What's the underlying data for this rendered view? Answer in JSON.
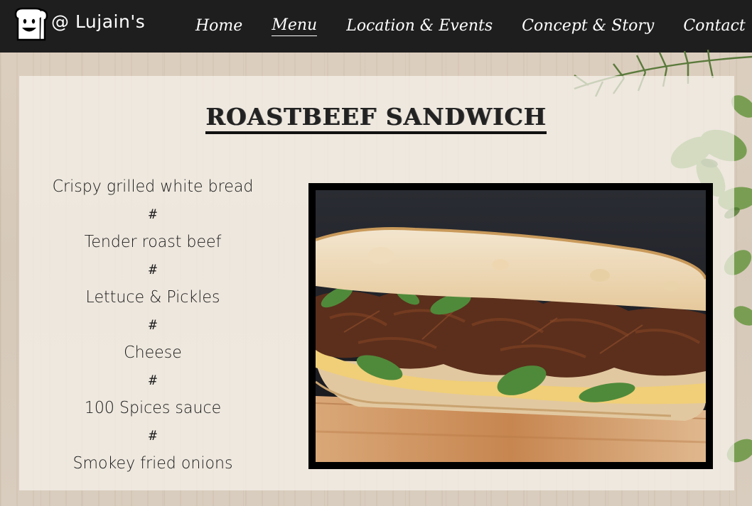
{
  "brand": {
    "name": "@ Lujain's",
    "logo_icon": "smiling-bread-logo"
  },
  "nav": {
    "items": [
      {
        "label": "Home",
        "active": false
      },
      {
        "label": "Menu",
        "active": true
      },
      {
        "label": "Location & Events",
        "active": false
      },
      {
        "label": "Concept & Story",
        "active": false
      },
      {
        "label": "Contact",
        "active": false
      }
    ]
  },
  "item": {
    "title": "ROASTBEEF SANDWICH",
    "ingredients": [
      "Crispy grilled white bread",
      "Tender roast beef",
      "Lettuce & Pickles",
      "Cheese",
      "100 Spices sauce",
      "Smokey fried onions"
    ],
    "separator": "#"
  },
  "colors": {
    "nav_bg": "#1e1e1e",
    "card_bg": "#f7f3ec",
    "frame": "#000000"
  }
}
